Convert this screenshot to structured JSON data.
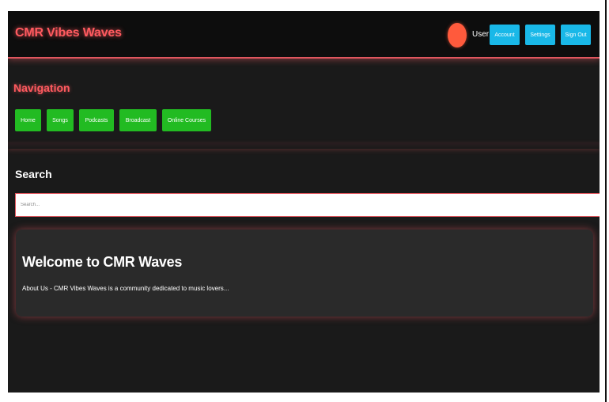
{
  "header": {
    "brand": "CMR Vibes Waves",
    "user_label": "User",
    "buttons": {
      "account": "Account",
      "settings": "Settings",
      "signout": "Sign Out"
    }
  },
  "navigation": {
    "title": "Navigation",
    "items": [
      {
        "label": "Home"
      },
      {
        "label": "Songs"
      },
      {
        "label": "Podcasts"
      },
      {
        "label": "Broadcast"
      },
      {
        "label": "Online Courses"
      }
    ]
  },
  "search": {
    "title": "Search",
    "placeholder": "Search..."
  },
  "welcome": {
    "title": "Welcome to CMR Waves",
    "text": "About Us - CMR Vibes Waves is a community dedicated to music lovers..."
  },
  "colors": {
    "accent": "#ff5a5f",
    "nav_button": "#22bb22",
    "header_button": "#19b8e8",
    "background": "#1a1a1a",
    "avatar": "#ff5a3c"
  }
}
